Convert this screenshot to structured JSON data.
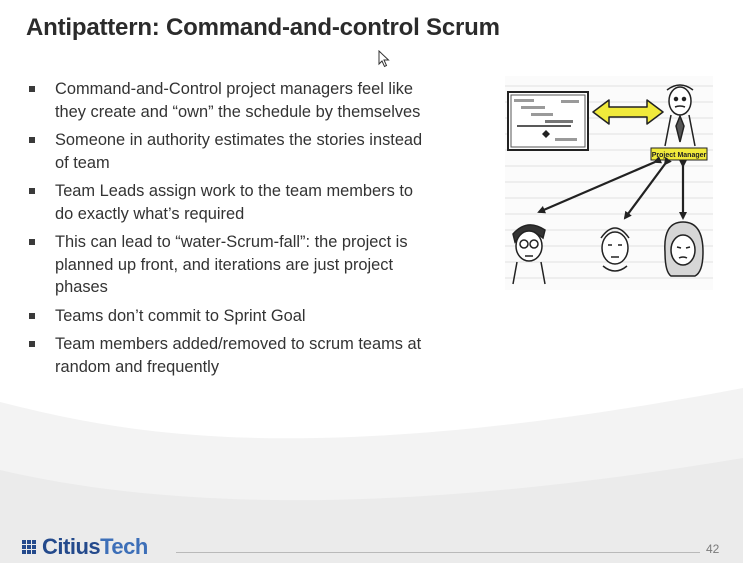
{
  "slide": {
    "title": "Antipattern: Command-and-control Scrum",
    "bullets": [
      "Command-and-Control project  managers feel like they create and  “own” the schedule by themselves",
      "Someone in authority estimates the stories instead of team",
      "Team Leads assign work to the team members to do exactly what’s required",
      "This can lead to “water-Scrum-fall”:  the project is planned up front, and  iterations are just project phases",
      "Teams don’t commit to Sprint Goal",
      "Team members added/removed to scrum teams at random and frequently"
    ],
    "illustration": {
      "label": "Project Manager",
      "icons": [
        "gantt-chart-icon",
        "double-arrow-icon",
        "manager-figure-icon",
        "team-member-icon"
      ]
    },
    "accent_color": "#244a8c"
  },
  "footer": {
    "logo_part1": "Citius",
    "logo_part2": "Tech",
    "page_number": "42"
  }
}
